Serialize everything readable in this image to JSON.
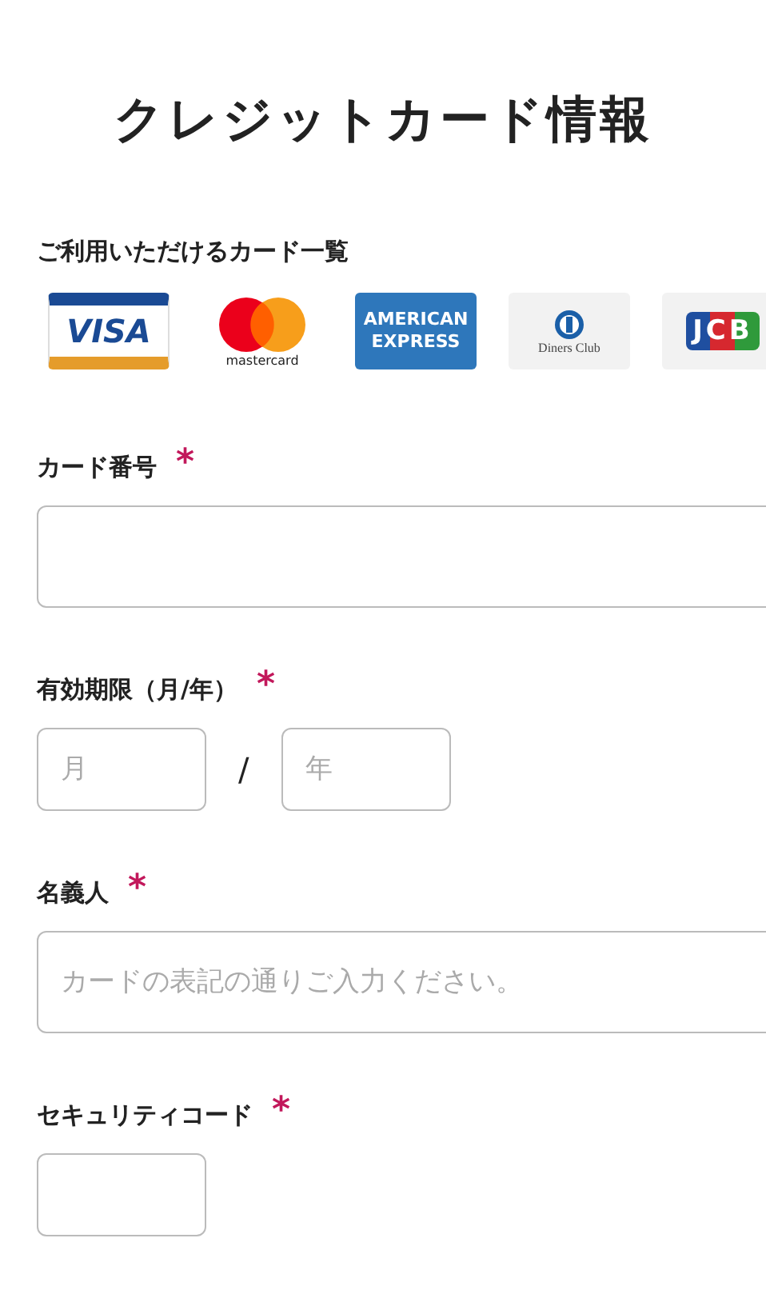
{
  "title": "クレジットカード情報",
  "cards_section": {
    "label": "ご利用いただけるカード一覧",
    "cards": [
      {
        "kind": "visa",
        "label": "VISA"
      },
      {
        "kind": "mastercard",
        "label": "mastercard"
      },
      {
        "kind": "amex",
        "label": "AMERICAN EXPRESS"
      },
      {
        "kind": "diners",
        "label": "Diners Club"
      },
      {
        "kind": "jcb",
        "label": "JCB"
      }
    ]
  },
  "fields": [
    {
      "kind": "wide",
      "label": "カード番号",
      "required_mark": "*"
    },
    {
      "kind": "expiry",
      "label": "有効期限（月/年）",
      "required_mark": "*",
      "month_placeholder": "月",
      "separator": "/",
      "year_placeholder": "年"
    },
    {
      "kind": "wide",
      "label": "名義人",
      "required_mark": "*",
      "placeholder": "カードの表記の通りご入力ください。"
    },
    {
      "kind": "short",
      "label": "セキュリティコード",
      "required_mark": "*"
    }
  ]
}
